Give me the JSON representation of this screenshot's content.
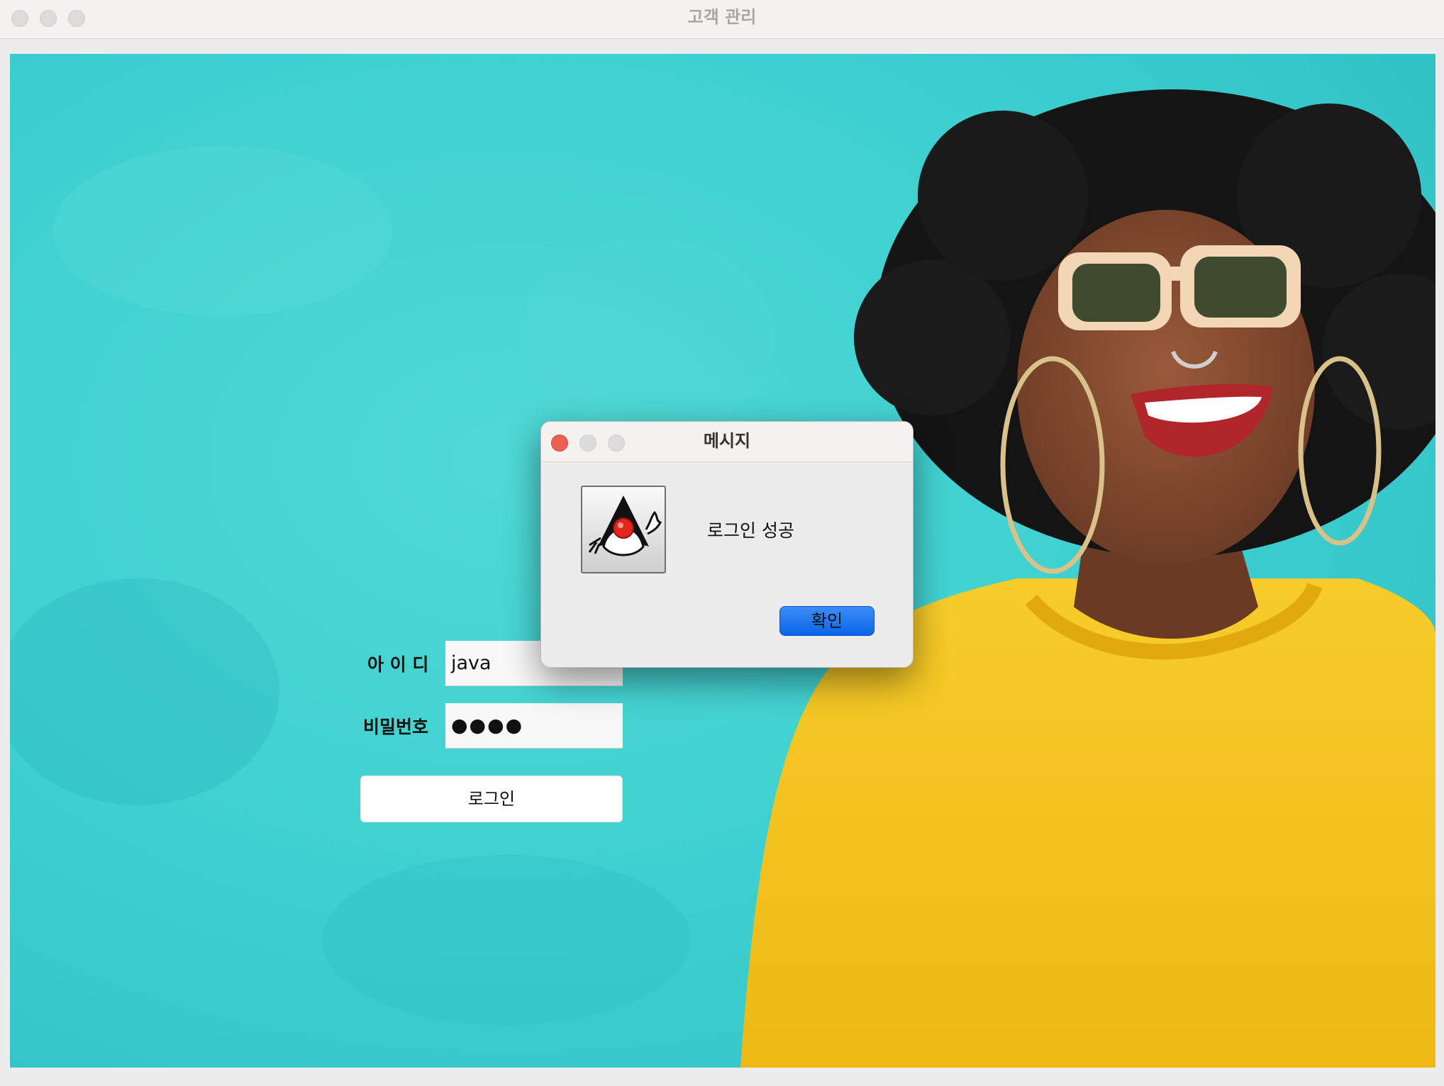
{
  "window": {
    "title": "고객 관리"
  },
  "background": {
    "description_icon": "photo-woman-sunglasses-yellow-sweater",
    "wall_color": "#3ccfcf",
    "sweater_color": "#f4c21d"
  },
  "login_form": {
    "id_label": "아 이 디",
    "id_value": "java",
    "password_label": "비밀번호",
    "password_value": "●●●●",
    "login_button": "로그인"
  },
  "dialog": {
    "title": "메시지",
    "icon": "java-duke-icon",
    "message": "로그인 성공",
    "ok_button": "확인"
  },
  "colors": {
    "accent": "#0b64e6",
    "close_red": "#ec5f55"
  }
}
